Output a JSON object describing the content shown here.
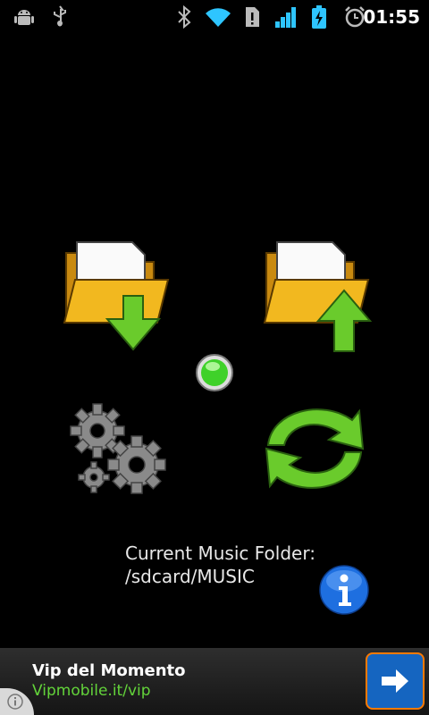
{
  "status_bar": {
    "time": "01:55",
    "icons": [
      "android-debug-icon",
      "usb-icon",
      "bluetooth-icon",
      "wifi-icon",
      "sim-alert-icon",
      "signal-icon",
      "battery-charging-icon",
      "alarm-icon"
    ]
  },
  "main": {
    "actions": [
      {
        "name": "import-folder-button",
        "icon": "folder-download-icon"
      },
      {
        "name": "export-folder-button",
        "icon": "folder-upload-icon"
      },
      {
        "name": "settings-button",
        "icon": "gears-icon"
      },
      {
        "name": "sync-button",
        "icon": "refresh-arrows-icon"
      }
    ],
    "status_led": {
      "icon": "green-led-icon",
      "color": "#3fd12a"
    },
    "current_folder_label": "Current Music Folder:",
    "current_folder_path": "/sdcard/MUSIC",
    "info_button_icon": "info-icon"
  },
  "ad_banner": {
    "title": "Vip del Momento",
    "link": "Vipmobile.it/vip",
    "link_color": "#63d43a",
    "go_icon": "arrow-right-icon",
    "info_icon": "ad-info-icon"
  },
  "colors": {
    "background": "#000000",
    "folder_yellow": "#f2b81f",
    "arrow_green": "#6acb2c",
    "gear_gray": "#8a8a8a",
    "info_blue": "#1e6fe0"
  }
}
